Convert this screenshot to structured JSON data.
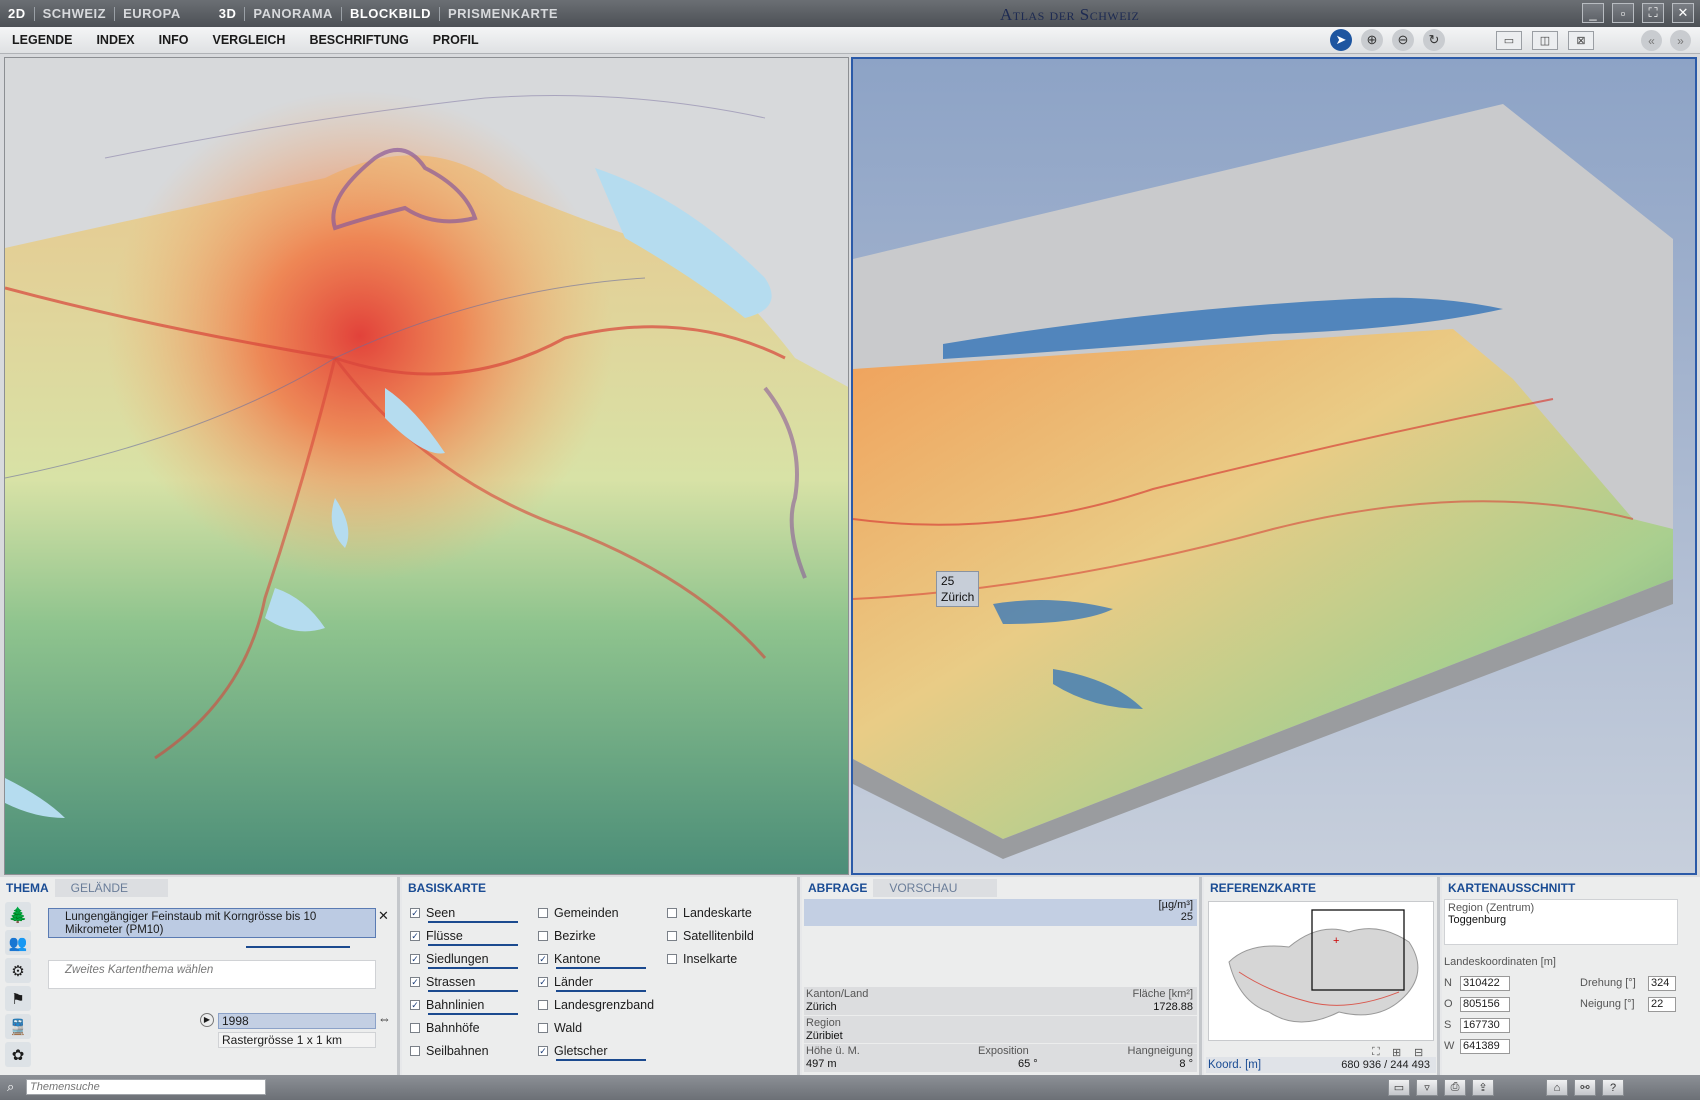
{
  "topbar": {
    "modes_2d": [
      "2D",
      "SCHWEIZ",
      "EUROPA"
    ],
    "modes_3d": [
      "3D",
      "PANORAMA",
      "BLOCKBILD",
      "PRISMENKARTE"
    ],
    "app_title": "Atlas der Schweiz"
  },
  "menu": {
    "items": [
      "LEGENDE",
      "INDEX",
      "INFO",
      "VERGLEICH",
      "BESCHRIFTUNG",
      "PROFIL"
    ]
  },
  "map3d": {
    "tooltip_value": "25",
    "tooltip_place": "Zürich"
  },
  "thema": {
    "tab_active": "THEMA",
    "tab_inactive": "GELÄNDE",
    "theme1": "Lungengängiger Feinstaub mit Korngrösse bis 10 Mikrometer (PM10)",
    "theme2_placeholder": "Zweites Kartenthema wählen",
    "year": "1998",
    "raster": "Rastergrösse 1 x 1 km"
  },
  "basiskarte": {
    "title": "BASISKARTE",
    "col1": [
      {
        "label": "Seen",
        "checked": true
      },
      {
        "label": "Flüsse",
        "checked": true
      },
      {
        "label": "Siedlungen",
        "checked": true
      },
      {
        "label": "Strassen",
        "checked": true
      },
      {
        "label": "Bahnlinien",
        "checked": true
      },
      {
        "label": "Bahnhöfe",
        "checked": false
      },
      {
        "label": "Seilbahnen",
        "checked": false
      }
    ],
    "col2": [
      {
        "label": "Gemeinden",
        "checked": false
      },
      {
        "label": "Bezirke",
        "checked": false
      },
      {
        "label": "Kantone",
        "checked": true
      },
      {
        "label": "Länder",
        "checked": true
      },
      {
        "label": "Landesgrenzband",
        "checked": false
      },
      {
        "label": "Wald",
        "checked": false
      },
      {
        "label": "Gletscher",
        "checked": true
      }
    ],
    "col3": [
      {
        "label": "Landeskarte",
        "checked": false
      },
      {
        "label": "Satellitenbild",
        "checked": false
      },
      {
        "label": "Inselkarte",
        "checked": false
      }
    ]
  },
  "abfrage": {
    "tab_active": "ABFRAGE",
    "tab_inactive": "VORSCHAU",
    "unit": "[µg/m³]",
    "value": "25",
    "kanton_label": "Kanton/Land",
    "kanton_value": "Zürich",
    "flaeche_label": "Fläche [km²]",
    "flaeche_value": "1728.88",
    "region_label": "Region",
    "region_value": "Züribiet",
    "hoehe_label": "Höhe ü. M.",
    "hoehe_value": "497 m",
    "exposition_label": "Exposition",
    "exposition_value": "65 °",
    "neigung_label": "Hangneigung",
    "neigung_value": "8 °"
  },
  "referenzkarte": {
    "title": "REFERENZKARTE",
    "koord_label": "Koord. [m]",
    "koord_value": "680 936 / 244 493"
  },
  "kartenausschnitt": {
    "title": "KARTENAUSSCHNITT",
    "region_label": "Region (Zentrum)",
    "region_value": "Toggenburg",
    "coords_label": "Landeskoordinaten [m]",
    "n_label": "N",
    "n_value": "310422",
    "o_label": "O",
    "o_value": "805156",
    "s_label": "S",
    "s_value": "167730",
    "w_label": "W",
    "w_value": "641389",
    "drehung_label": "Drehung [°]",
    "drehung_value": "324",
    "neigung_label": "Neigung [°]",
    "neigung_value": "22"
  },
  "statusbar": {
    "search_placeholder": "Themensuche"
  }
}
